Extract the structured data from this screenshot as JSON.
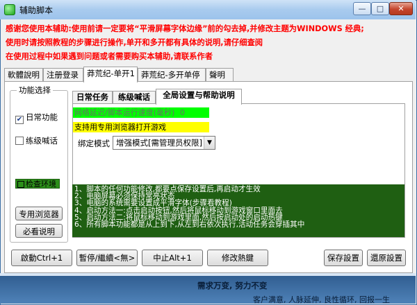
{
  "window": {
    "title": "辅助脚本",
    "min_glyph": "—",
    "max_glyph": "□",
    "close_glyph": "✕"
  },
  "notices": [
    "感谢您使用本辅助:使用前请一定要将“平滑屏幕字体边缘”前的勾去掉,并修改主题为WINDOWS 经典;",
    "使用时请按照教程的步骤进行操作,单开和多开都有具体的说明,请仔细查阅",
    "在使用过程中如果遇到问题或者需要购买本辅助,请联系作者"
  ],
  "tabs": [
    "軟體說明",
    "注册登录",
    "莽荒纪-单开1",
    "莽荒纪-多开单停",
    "聲明"
  ],
  "left_panel": {
    "group_title": "功能选择",
    "checkbox_daily": "日常功能",
    "checkbox_level": "练级喊话",
    "env_check": "检查环境",
    "browser_button": "专用浏览器",
    "must_read_button": "必看说明"
  },
  "inner_tabs": [
    "日常任务",
    "练级喊话",
    "全局设置与帮助说明"
  ],
  "settings": {
    "delay_label": "网络延迟/脚本运行速度(毫秒)",
    "delay_value": "0",
    "browser_note": "支持用专用浏览器打开游戏",
    "bind_mode_label": "绑定模式",
    "bind_mode_selected": "增强模式[需管理员权限]",
    "dropdown_arrow": "▼"
  },
  "help_lines": [
    "1、脚本的任何功能修改,都要点保存设置后,再启动才生效",
    "2、电脑屏幕必须保持常亮状态",
    "3、电脑的系统需要设置成平滑字体(步骤看教程)",
    "4、启动方法一:点击启动按钮,然后将鼠标移动到游戏窗口里面去",
    "5、启动方法二:将鼠标移动到游戏里面,然后按启动处的启动热键",
    "6、所有脚本功能都是从上到下,从左到右依次执行,活动任务会穿插其中"
  ],
  "bottom_buttons": {
    "start": "啟動Ctrl+1",
    "pause": "暫停/繼續<無>",
    "stop": "中止Alt+1",
    "hotkey": "修改熱鍵",
    "save": "保存設置",
    "restore": "還原設置"
  },
  "footer": {
    "slogan1": "需求万变, 努力不变",
    "slogan2": "客户满意, 人脉延伸, 良性循环, 回报一生"
  },
  "colors": {
    "notice_red": "#ff0000",
    "delay_green": "#00ff00",
    "note_yellow": "#ffff00",
    "help_bg": "#1f5f12"
  }
}
